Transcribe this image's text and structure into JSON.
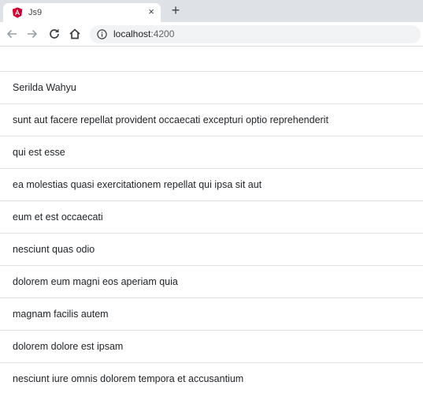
{
  "browser": {
    "tab": {
      "title": "Js9",
      "close_label": "×"
    },
    "new_tab_label": "+",
    "address": {
      "host": "localhost",
      "port": ":4200"
    }
  },
  "list": {
    "items": [
      "Serilda Wahyu",
      "sunt aut facere repellat provident occaecati excepturi optio reprehenderit",
      "qui est esse",
      "ea molestias quasi exercitationem repellat qui ipsa sit aut",
      "eum et est occaecati",
      "nesciunt quas odio",
      "dolorem eum magni eos aperiam quia",
      "magnam facilis autem",
      "dolorem dolore est ipsam",
      "nesciunt iure omnis dolorem tempora et accusantium"
    ]
  },
  "colors": {
    "tabstrip": "#dee1e6",
    "angular_red": "#dd0031",
    "divider": "#dfdfdf",
    "text": "#212529"
  }
}
